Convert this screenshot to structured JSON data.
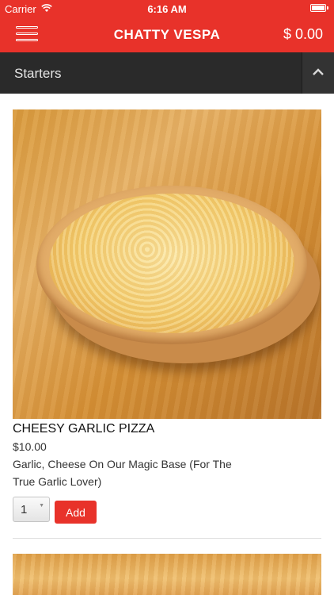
{
  "status_bar": {
    "carrier": "Carrier",
    "time": "6:16 AM"
  },
  "nav": {
    "title": "CHATTY VESPA",
    "cart_total": "$  0.00",
    "menu_icon": "hamburger-menu-icon"
  },
  "category": {
    "title": "Starters",
    "toggle_icon": "chevron-up-icon"
  },
  "products": [
    {
      "name": "CHEESY GARLIC PIZZA",
      "price": "$10.00",
      "description": "Garlic, Cheese On Our Magic Base (For The True Garlic Lover)",
      "quantity": "1",
      "add_label": "Add"
    }
  ],
  "colors": {
    "accent": "#e8322a",
    "category_bar": "#2a2a2a"
  }
}
